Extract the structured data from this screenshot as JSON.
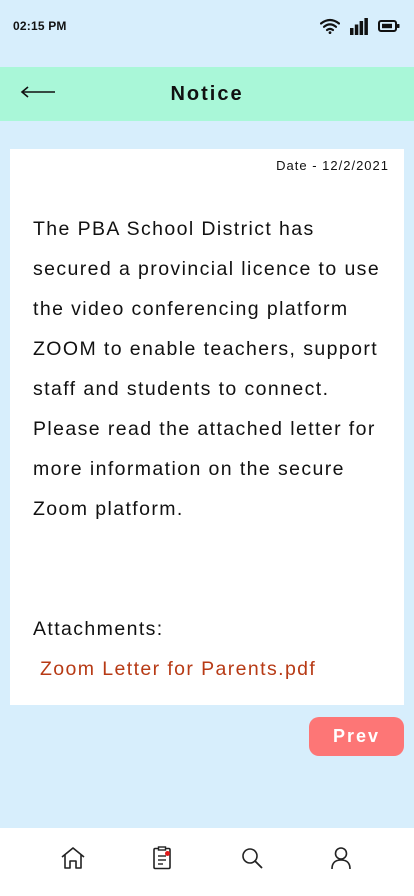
{
  "status_bar": {
    "time": "02:15 PM",
    "icons": [
      "wifi-icon",
      "signal-icon",
      "battery-icon"
    ]
  },
  "header": {
    "title": "Notice",
    "back_icon": "arrow-left-icon"
  },
  "notice": {
    "date": "Date - 12/2/2021",
    "body": "The PBA School District has secured a provincial licence to use the video conferencing platform ZOOM to enable teachers, support staff and students to connect. Please read the attached letter for more information on the secure Zoom platform.",
    "attachments_label": "Attachments:",
    "attachment_name": "Zoom Letter for Parents.pdf"
  },
  "actions": {
    "prev_label": "Prev"
  },
  "bottom_nav": {
    "items": [
      {
        "icon": "home-icon"
      },
      {
        "icon": "notice-icon",
        "has_badge": true
      },
      {
        "icon": "search-icon"
      },
      {
        "icon": "profile-icon"
      }
    ]
  },
  "colors": {
    "background": "#d7eefc",
    "header": "#a9f7d8",
    "prev_button": "#fd7676",
    "link": "#b73a15",
    "badge": "#e01b1b"
  }
}
